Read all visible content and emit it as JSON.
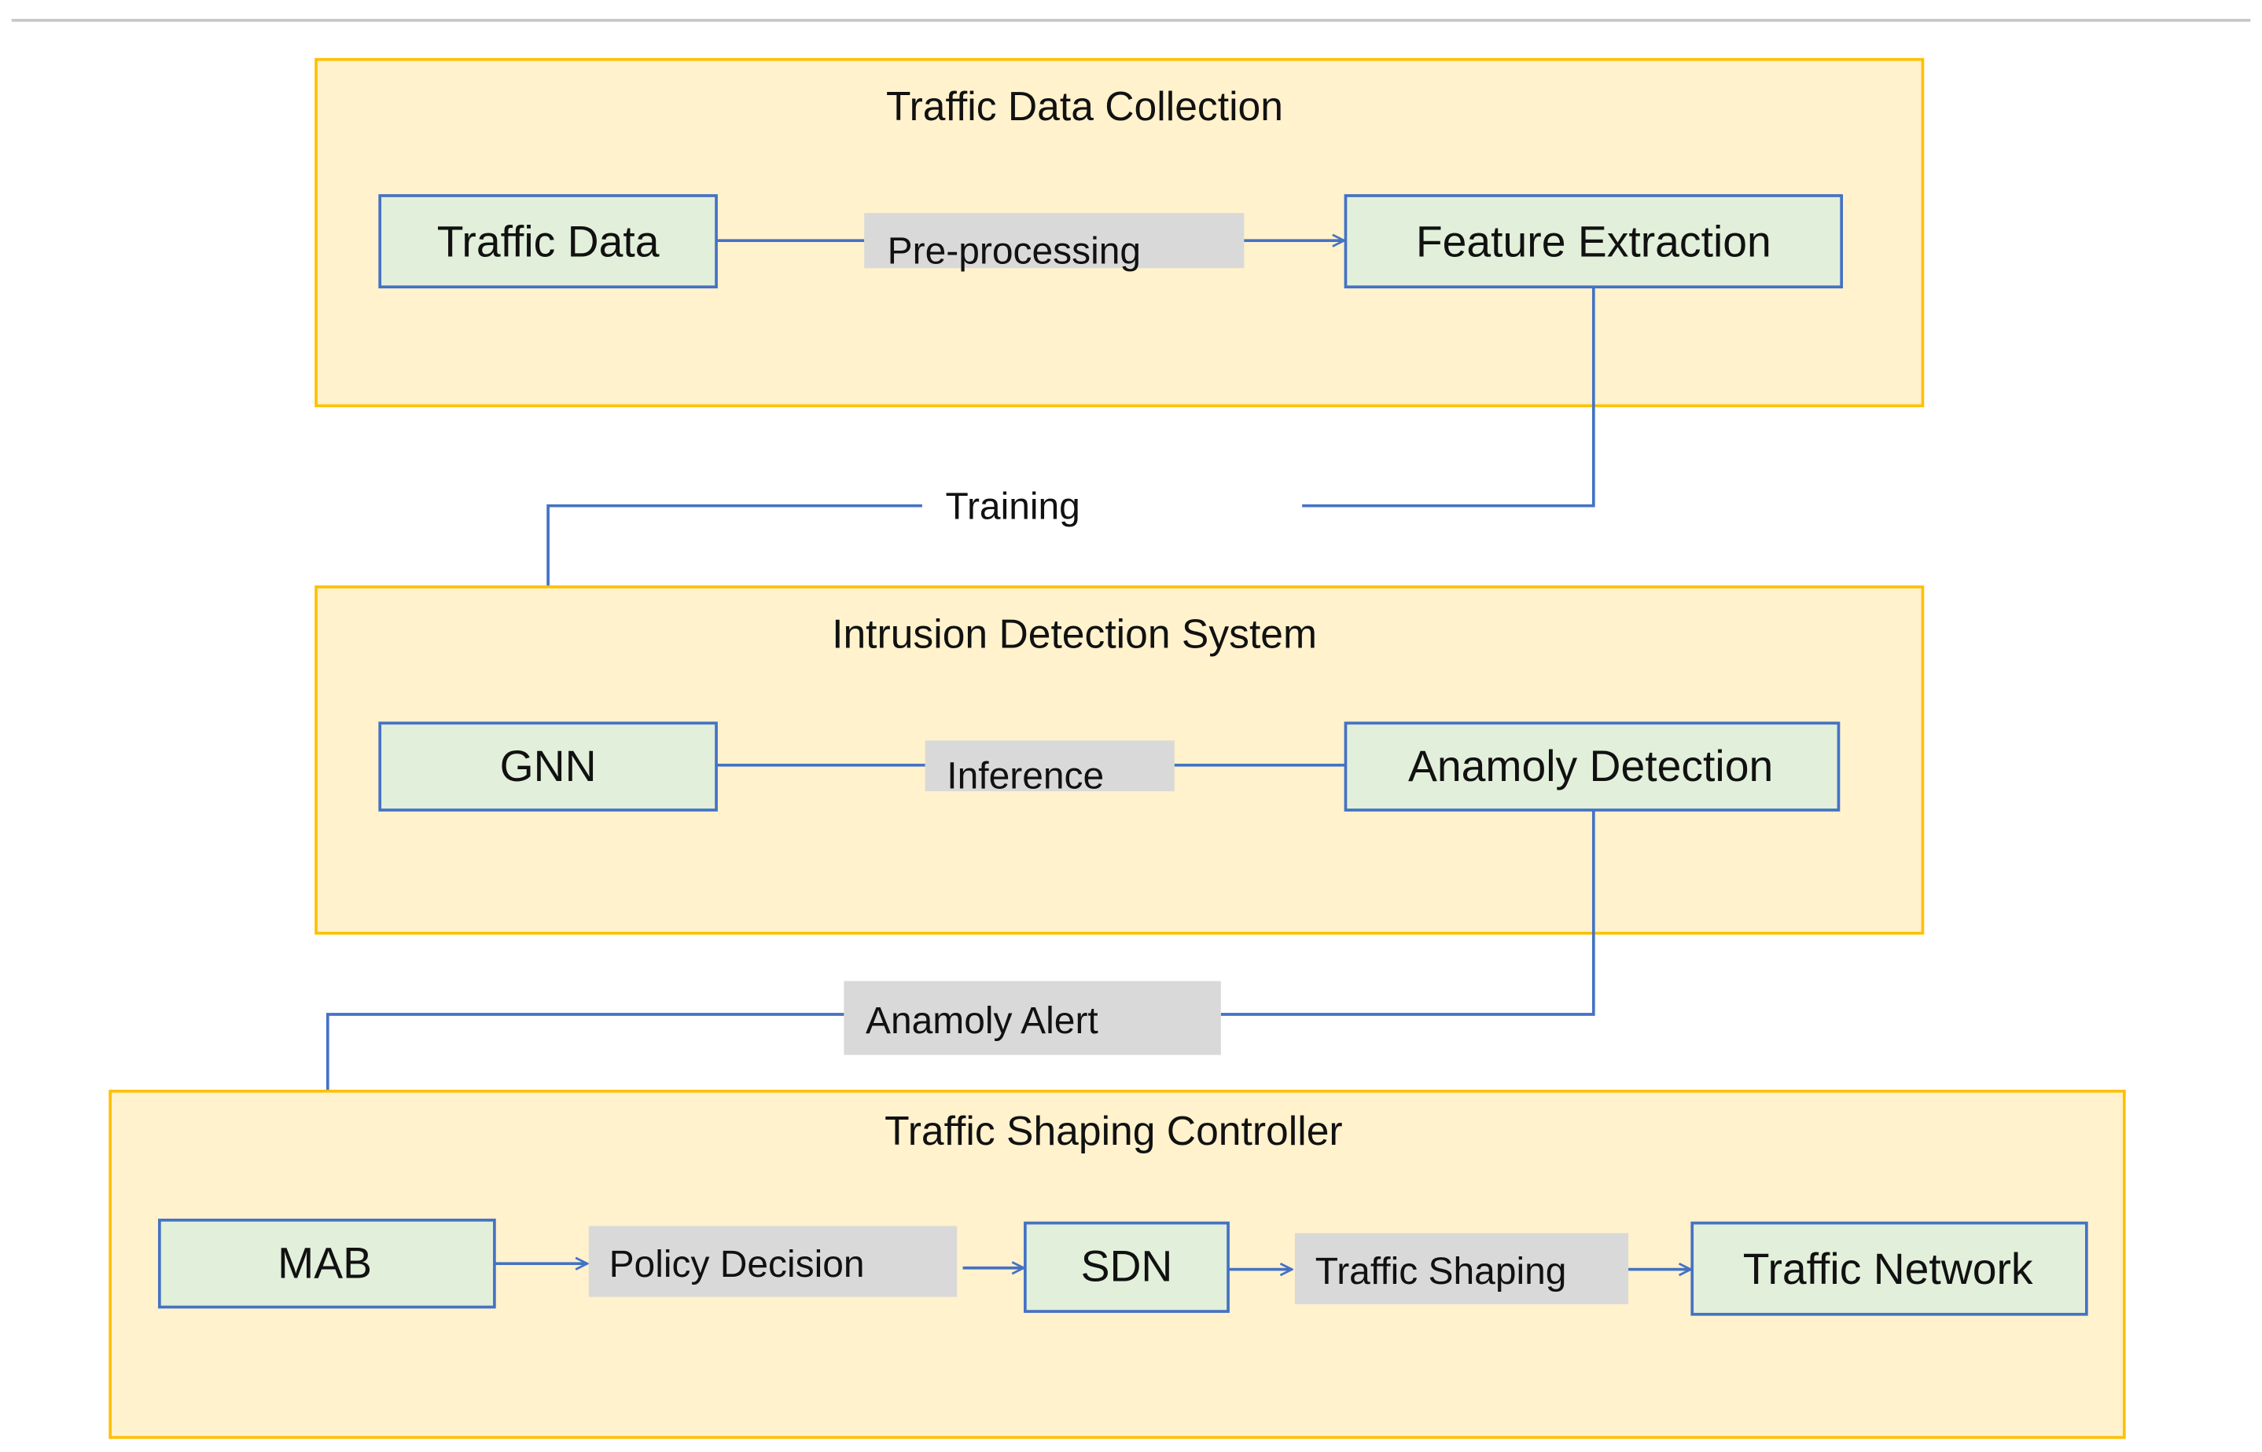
{
  "colors": {
    "group_fill": "#fff2cc",
    "group_border": "#ffc000",
    "node_fill": "#e2efda",
    "node_border": "#4472c4",
    "edge_label_fill": "#d9d9d9",
    "edge": "#4472c4"
  },
  "groups": {
    "collection": {
      "title": "Traffic Data Collection",
      "nodes": {
        "traffic_data": "Traffic Data",
        "feature_extraction": "Feature Extraction"
      },
      "edges": {
        "preprocessing": "Pre-processing"
      }
    },
    "ids": {
      "title": "Intrusion Detection System",
      "nodes": {
        "gnn": "GNN",
        "anomaly_detection": "Anamoly Detection"
      },
      "edges": {
        "inference": "Inference"
      }
    },
    "shaping": {
      "title": "Traffic Shaping Controller",
      "nodes": {
        "mab": "MAB",
        "sdn": "SDN",
        "traffic_network": "Traffic Network"
      },
      "edges": {
        "policy_decision": "Policy Decision",
        "traffic_shaping": "Traffic Shaping"
      }
    }
  },
  "connections": {
    "training": "Training",
    "anomaly_alert": "Anamoly Alert"
  }
}
